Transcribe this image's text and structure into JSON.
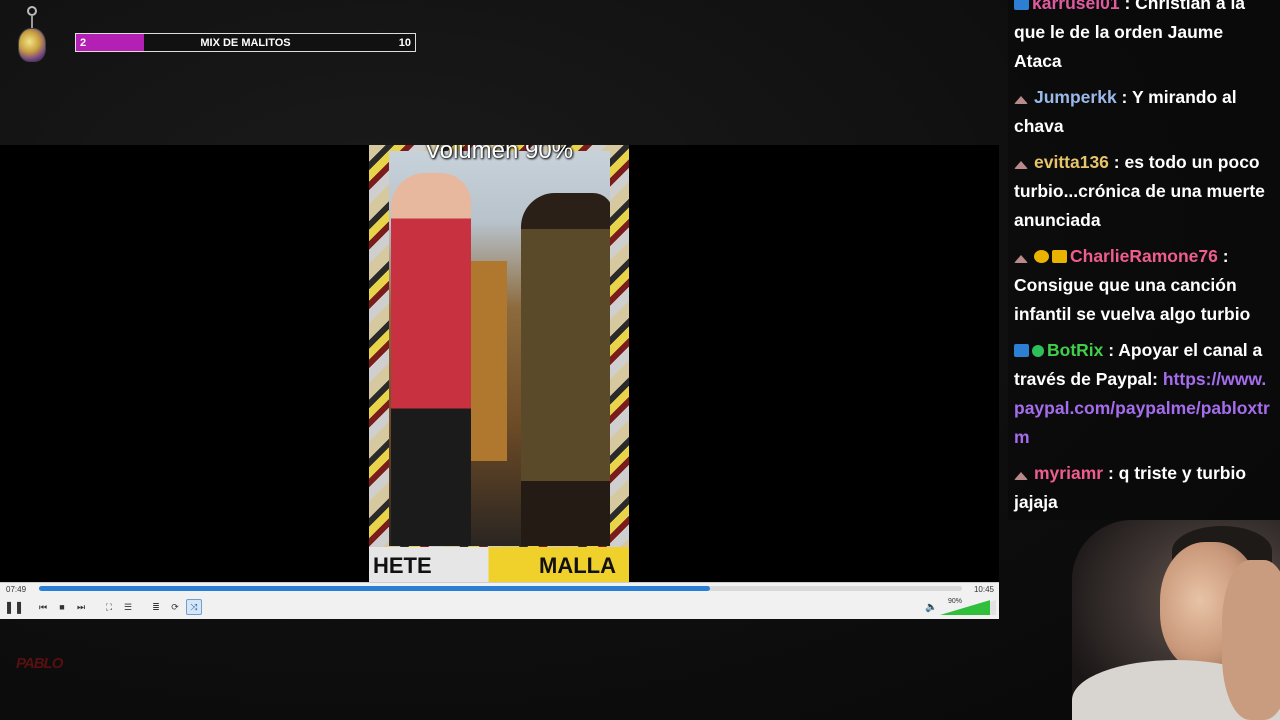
{
  "overlay": {
    "progress": {
      "min": "2",
      "max": "10",
      "current": 2,
      "label": "MIX DE MALITOS"
    },
    "brand": "PABLO"
  },
  "video": {
    "caption": "Volumen 90%",
    "poster_text_left": "HETE",
    "poster_text_right": "MALLA"
  },
  "player": {
    "time_current": "07:49",
    "time_total": "10:45",
    "progress": 0.727,
    "volume_label": "90%",
    "volume": 0.9,
    "controls": [
      {
        "name": "play-pause-button",
        "icon": "pause-icon",
        "glyph": "❚❚"
      },
      {
        "name": "previous-button",
        "icon": "previous-icon",
        "glyph": "⏮"
      },
      {
        "name": "stop-button",
        "icon": "stop-icon",
        "glyph": "■"
      },
      {
        "name": "next-button",
        "icon": "next-icon",
        "glyph": "⏭"
      },
      {
        "name": "fullscreen-button",
        "icon": "fullscreen-icon",
        "glyph": "⛶"
      },
      {
        "name": "extended-settings-button",
        "icon": "equalizer-icon",
        "glyph": "☰"
      },
      {
        "name": "playlist-button",
        "icon": "playlist-icon",
        "glyph": "≣"
      },
      {
        "name": "loop-button",
        "icon": "loop-icon",
        "glyph": "⟳"
      },
      {
        "name": "shuffle-button",
        "icon": "shuffle-icon",
        "glyph": "⤨"
      }
    ]
  },
  "chat": {
    "messages": [
      {
        "user": "karrusel01",
        "color": "#e05aa0",
        "badges": [
          "mod"
        ],
        "text": "Christian a la que le de la orden Jaume Ataca"
      },
      {
        "user": "Jumperkk",
        "color": "#9ab8e8",
        "badges": [
          "gray"
        ],
        "text": "Y mirando al chava"
      },
      {
        "user": "evitta136",
        "color": "#e6c46a",
        "badges": [
          "gray"
        ],
        "text": "es todo un poco turbio...crónica de una muerte anunciada"
      },
      {
        "user": "CharlieRamone76",
        "color": "#ef5d8e",
        "badges": [
          "gray",
          "gold",
          "crown"
        ],
        "text": "Consigue que una canción infantil se vuelva algo turbio"
      },
      {
        "user": "BotRix",
        "color": "#3fcf4a",
        "badges": [
          "mod",
          "verified"
        ],
        "text": "Apoyar el canal a través de Paypal:",
        "link": "https://www.paypal.com/paypalme/pabloxtrm"
      },
      {
        "user": "myriamr",
        "color": "#ef5d8e",
        "badges": [
          "gray"
        ],
        "text": "q triste y turbio jajaja"
      }
    ]
  },
  "colors": {
    "accent_progress": "#b41fb4",
    "seek": "#2a7fd4",
    "volume": "#2fbf3a"
  }
}
